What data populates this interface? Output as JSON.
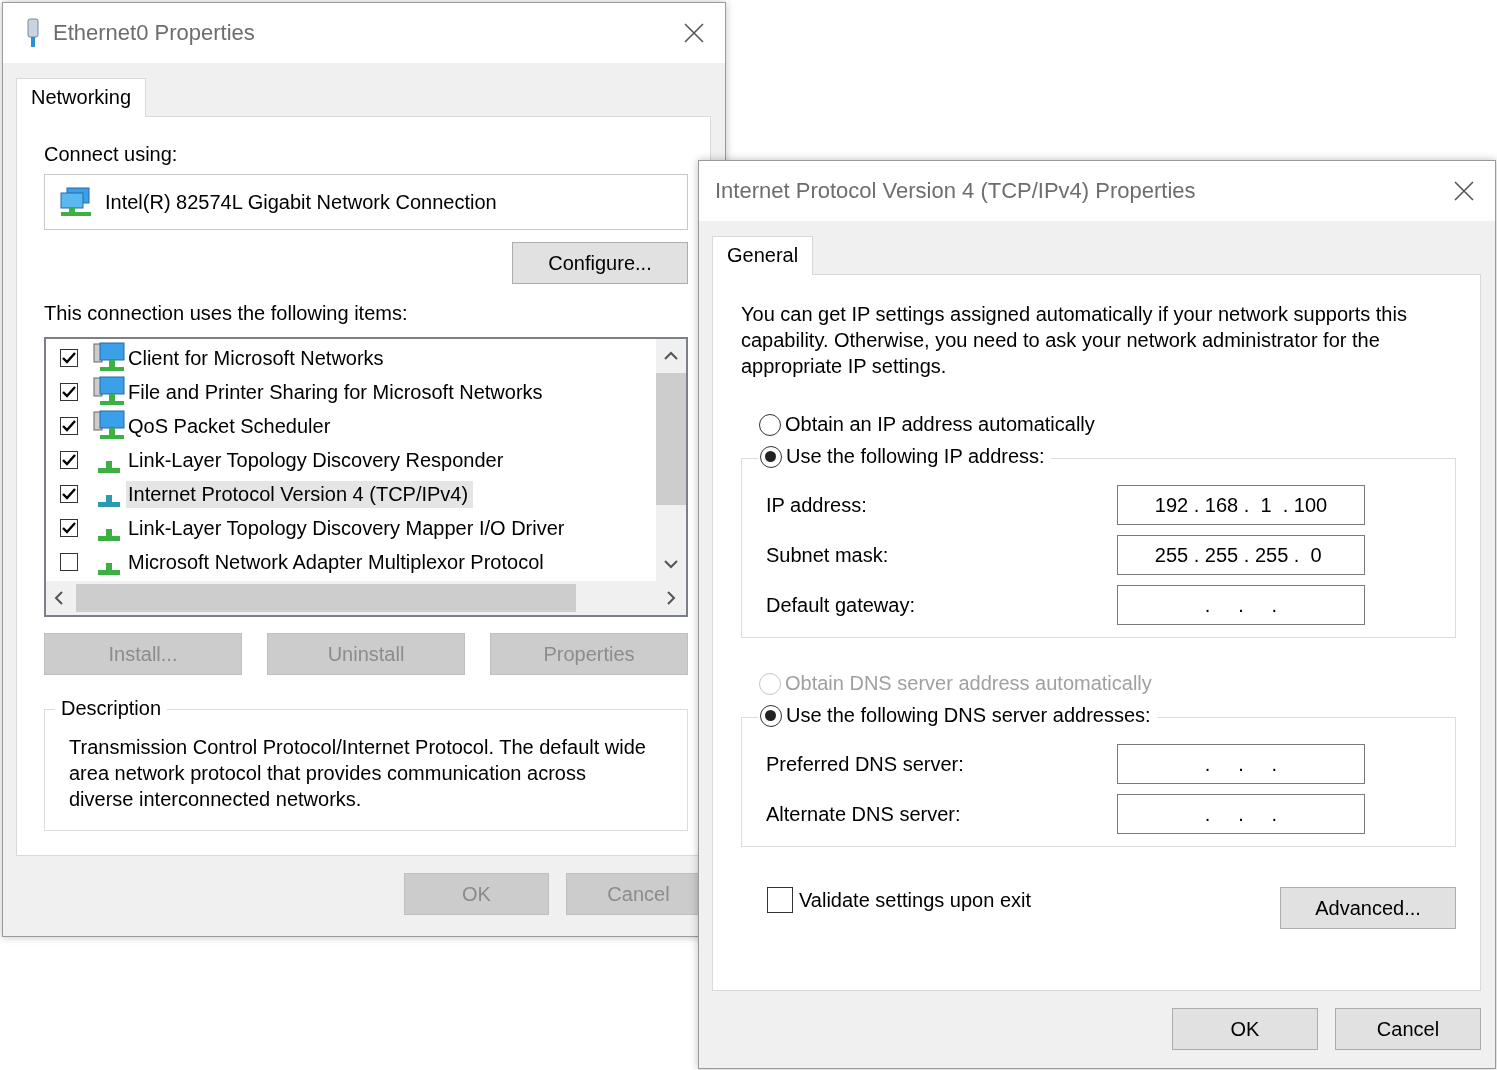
{
  "ethernet_window": {
    "title": "Ethernet0 Properties",
    "tabs": [
      {
        "label": "Networking",
        "selected": true
      }
    ],
    "connect_using_label": "Connect using:",
    "adapter": "Intel(R) 82574L Gigabit Network Connection",
    "configure_button": "Configure...",
    "items_label": "This connection uses the following items:",
    "items": [
      {
        "label": "Client for Microsoft Networks",
        "kind": "service",
        "checked": true,
        "selected": false
      },
      {
        "label": "File and Printer Sharing for Microsoft Networks",
        "kind": "service",
        "checked": true,
        "selected": false
      },
      {
        "label": "QoS Packet Scheduler",
        "kind": "service",
        "checked": true,
        "selected": false
      },
      {
        "label": "Link-Layer Topology Discovery Responder",
        "kind": "protocol",
        "checked": true,
        "selected": false
      },
      {
        "label": "Internet Protocol Version 4 (TCP/IPv4)",
        "kind": "protocol",
        "checked": true,
        "selected": true
      },
      {
        "label": "Link-Layer Topology Discovery Mapper I/O Driver",
        "kind": "protocol",
        "checked": true,
        "selected": false
      },
      {
        "label": "Microsoft Network Adapter Multiplexor Protocol",
        "kind": "protocol",
        "checked": false,
        "selected": false
      }
    ],
    "item_buttons": [
      {
        "label": "Install...",
        "disabled": true
      },
      {
        "label": "Uninstall",
        "disabled": true
      },
      {
        "label": "Properties",
        "disabled": true
      }
    ],
    "description": {
      "heading": "Description",
      "text": "Transmission Control Protocol/Internet Protocol. The default wide area network protocol that provides communication across diverse interconnected networks."
    },
    "buttons": [
      {
        "label": "OK",
        "disabled": true
      },
      {
        "label": "Cancel",
        "disabled": true
      }
    ]
  },
  "ipv4_window": {
    "title": "Internet Protocol Version 4 (TCP/IPv4) Properties",
    "tabs": [
      {
        "label": "General",
        "selected": true
      }
    ],
    "intro": "You can get IP settings assigned automatically if your network supports this capability. Otherwise, you need to ask your network administrator for the appropriate IP settings.",
    "ip_auto": {
      "label": "Obtain an IP address automatically",
      "selected": false,
      "disabled": false
    },
    "ip_manual": {
      "label": "Use the following IP address:",
      "selected": true,
      "disabled": false
    },
    "ip_fields": [
      {
        "label": "IP address:",
        "value": "192 . 168 .  1  . 100"
      },
      {
        "label": "Subnet mask:",
        "value": "255 . 255 . 255 .  0 "
      },
      {
        "label": "Default gateway:",
        "value": "    .     .     .    "
      }
    ],
    "dns_auto": {
      "label": "Obtain DNS server address automatically",
      "selected": false,
      "disabled": true
    },
    "dns_manual": {
      "label": "Use the following DNS server addresses:",
      "selected": true,
      "disabled": false
    },
    "dns_fields": [
      {
        "label": "Preferred DNS server:",
        "value": "    .     .     .    "
      },
      {
        "label": "Alternate DNS server:",
        "value": "    .     .     .    "
      }
    ],
    "validate": {
      "label": "Validate settings upon exit",
      "checked": false
    },
    "advanced_button": "Advanced...",
    "buttons": [
      {
        "label": "OK",
        "disabled": false
      },
      {
        "label": "Cancel",
        "disabled": false
      }
    ]
  }
}
